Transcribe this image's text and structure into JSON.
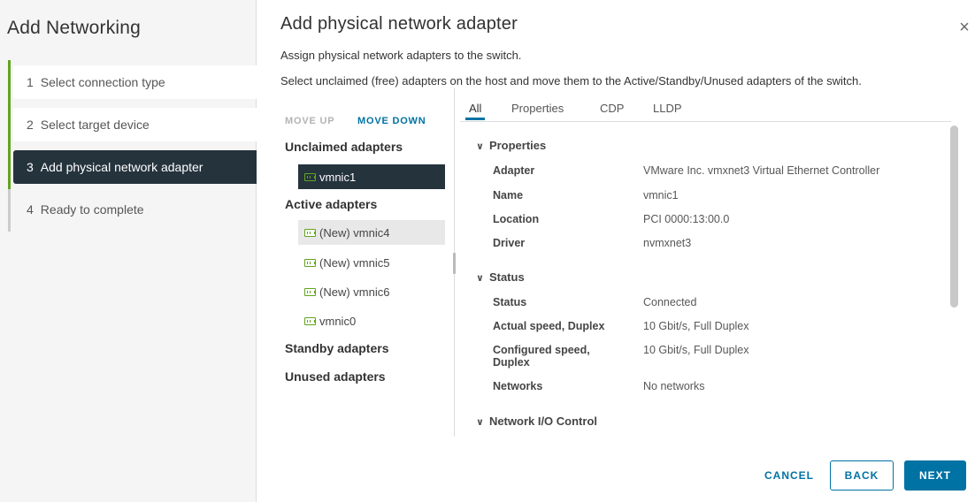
{
  "wizard": {
    "title": "Add Networking",
    "steps": [
      {
        "num": "1",
        "label": "Select connection type"
      },
      {
        "num": "2",
        "label": "Select target device"
      },
      {
        "num": "3",
        "label": "Add physical network adapter"
      },
      {
        "num": "4",
        "label": "Ready to complete"
      }
    ]
  },
  "dialog": {
    "title": "Add physical network adapter",
    "description": "Assign physical network adapters to the switch.",
    "instruction": "Select unclaimed (free) adapters on the host and move them to the Active/Standby/Unused adapters of the switch.",
    "close_icon": "×"
  },
  "adapters": {
    "move_up": "MOVE UP",
    "move_down": "MOVE DOWN",
    "groups": {
      "unclaimed": "Unclaimed adapters",
      "active": "Active adapters",
      "standby": "Standby adapters",
      "unused": "Unused adapters"
    },
    "unclaimed_items": [
      "vmnic1"
    ],
    "active_items": [
      "(New) vmnic4",
      "(New) vmnic5",
      "(New) vmnic6",
      "vmnic0"
    ]
  },
  "tabs": [
    "All",
    "Properties",
    "CDP",
    "LLDP"
  ],
  "details": {
    "chevron": "∨",
    "properties": {
      "heading": "Properties",
      "rows": [
        {
          "key": "Adapter",
          "value": "VMware Inc. vmxnet3 Virtual Ethernet Controller"
        },
        {
          "key": "Name",
          "value": "vmnic1"
        },
        {
          "key": "Location",
          "value": "PCI 0000:13:00.0"
        },
        {
          "key": "Driver",
          "value": "nvmxnet3"
        }
      ]
    },
    "status": {
      "heading": "Status",
      "rows": [
        {
          "key": "Status",
          "value": "Connected"
        },
        {
          "key": "Actual speed, Duplex",
          "value": "10 Gbit/s, Full Duplex"
        },
        {
          "key": "Configured speed, Duplex",
          "value": "10 Gbit/s, Full Duplex"
        },
        {
          "key": "Networks",
          "value": "No networks"
        }
      ]
    },
    "nioc": {
      "heading": "Network I/O Control"
    }
  },
  "footer": {
    "cancel": "CANCEL",
    "back": "BACK",
    "next": "NEXT"
  },
  "colors": {
    "accent": "#0072a3",
    "active_step": "#25333d",
    "progress": "#62a420"
  }
}
